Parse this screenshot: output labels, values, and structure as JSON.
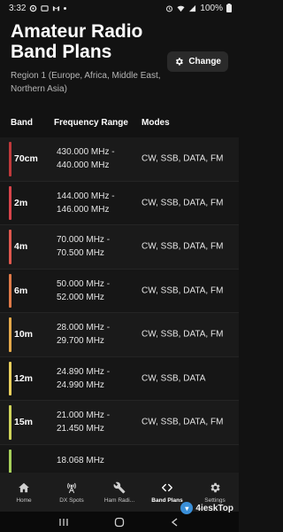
{
  "status": {
    "time": "3:32",
    "battery": "100%"
  },
  "header": {
    "title": "Amateur Radio Band Plans",
    "subtitle": "Region 1 (Europe, Africa, Middle East, Northern Asia)",
    "change_label": "Change"
  },
  "columns": {
    "band": "Band",
    "freq": "Frequency Range",
    "modes": "Modes"
  },
  "bands": [
    {
      "band": "70cm",
      "freq": "430.000 MHz - 440.000 MHz",
      "modes": "CW, SSB, DATA, FM",
      "color": "#c0393b"
    },
    {
      "band": "2m",
      "freq": "144.000 MHz - 146.000 MHz",
      "modes": "CW, SSB, DATA, FM",
      "color": "#d9444b"
    },
    {
      "band": "4m",
      "freq": "70.000 MHz - 70.500 MHz",
      "modes": "CW, SSB, DATA, FM",
      "color": "#e0584e"
    },
    {
      "band": "6m",
      "freq": "50.000 MHz - 52.000 MHz",
      "modes": "CW, SSB, DATA, FM",
      "color": "#e07a48"
    },
    {
      "band": "10m",
      "freq": "28.000 MHz - 29.700 MHz",
      "modes": "CW, SSB, DATA, FM",
      "color": "#e5a94a"
    },
    {
      "band": "12m",
      "freq": "24.890 MHz - 24.990 MHz",
      "modes": "CW, SSB, DATA",
      "color": "#e9cf5c"
    },
    {
      "band": "15m",
      "freq": "21.000 MHz - 21.450 MHz",
      "modes": "CW, SSB, DATA, FM",
      "color": "#cfd45a"
    },
    {
      "band": "",
      "freq": "18.068 MHz",
      "modes": "",
      "color": "#a6cf5a"
    }
  ],
  "nav": {
    "home": "Home",
    "dx": "DX Spots",
    "ham": "Ham Radi...",
    "plans": "Band Plans",
    "settings": "Settings"
  },
  "watermark": "4ieskTop"
}
